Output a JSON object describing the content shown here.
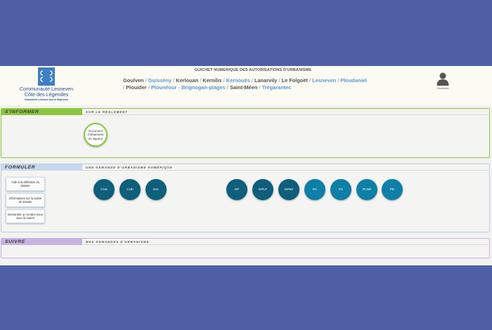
{
  "colors": {
    "background": "#4f5fa6",
    "inform_accent": "#8cc63f",
    "form_accent": "#c6d8ec",
    "follow_accent": "#c7b3e3",
    "circle_dark": "#0d5f7c",
    "circle_light": "#0e7fa6"
  },
  "header": {
    "logo_name": "Communauté Lesneven Côte des Légendes",
    "logo_sub": "Kumuniezh Lesneven Aod ar Mojennoù",
    "portal_title": "GUICHET NUMERIQUE DES AUTORISATIONS D'URBANISME",
    "communes": [
      {
        "name": "Goulven",
        "style": "dark"
      },
      {
        "name": "Guissény",
        "style": "blue"
      },
      {
        "name": "Kerlouan",
        "style": "dark"
      },
      {
        "name": "Kernilis",
        "style": "dark"
      },
      {
        "name": "Kernouës",
        "style": "blue"
      },
      {
        "name": "Lanarvily",
        "style": "dark"
      },
      {
        "name": "Le Folgoët",
        "style": "dark"
      },
      {
        "name": "Lesneven",
        "style": "blue"
      },
      {
        "name": "Ploudaniel",
        "style": "blue"
      },
      {
        "name": "Plouider",
        "style": "dark"
      },
      {
        "name": "Plounéour - Brignogan-plages",
        "style": "blue"
      },
      {
        "name": "Saint-Méen",
        "style": "dark"
      },
      {
        "name": "Trégarantec",
        "style": "blue"
      }
    ],
    "user_label": "Connexion",
    "user_icon": "user-icon"
  },
  "inform": {
    "label": "S'INFORMER",
    "sub": "SUR LE RÈGLEMENT",
    "doc_button": "Document d'urbanisme en vigueur"
  },
  "form": {
    "label": "FORMULER",
    "sub": "UNE DEMANDE D'URBANISME NUMÉRIQUE",
    "side_buttons": [
      "Aide à la définition du dossier",
      "Informations sur la saisie de dossier",
      "Demander un rendez-vous avec la mairie"
    ],
    "request_buttons": [
      "CUa",
      "CUb",
      "DIA",
      "DP",
      "DPLT",
      "DPMI",
      "PA",
      "PC",
      "PCMI",
      "PD"
    ]
  },
  "follow": {
    "label": "SUIVRE",
    "sub": "MES DEMANDES D'URBANISME"
  }
}
